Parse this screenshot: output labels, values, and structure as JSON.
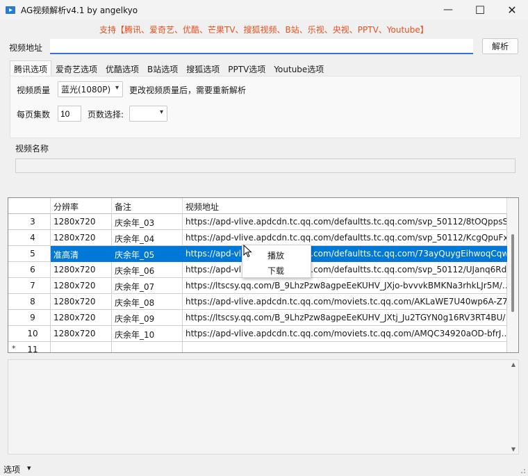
{
  "window": {
    "title": "AG视频解析v4.1 by angelkyo",
    "minimize_icon": "—",
    "maximize_icon": "☐",
    "close_icon": "✕"
  },
  "banner": "支持【腾讯、爱奇艺、优酷、芒果TV、搜狐视频、B站、乐视、央视、PPTV、Youtube】",
  "url_label": "视频地址",
  "url_value": "",
  "parse_button": "解析",
  "tabs": [
    "腾讯选项",
    "爱奇艺选项",
    "优酷选项",
    "B站选项",
    "搜狐选项",
    "PPTV选项",
    "Youtube选项"
  ],
  "quality": {
    "label": "视频质量",
    "value": "蓝光(1080P)",
    "note": "更改视频质量后，需要重新解析"
  },
  "paging": {
    "per_page_label": "每页集数",
    "per_page_value": "10",
    "page_select_label": "页数选择:",
    "page_select_value": ""
  },
  "video_name_label": "视频名称",
  "video_name_value": "",
  "table": {
    "columns": [
      "分辨率",
      "备注",
      "视频地址"
    ],
    "rows": [
      {
        "num": "3",
        "res": "1280x720",
        "note": "庆余年_03",
        "url": "https://apd-vlive.apdcdn.tc.qq.com/defaultts.tc.qq.com/svp_50112/8tOQppsS…"
      },
      {
        "num": "4",
        "res": "1280x720",
        "note": "庆余年_04",
        "url": "https://apd-vlive.apdcdn.tc.qq.com/defaultts.tc.qq.com/svp_50112/KcgQpuFx…"
      },
      {
        "num": "5",
        "res": "准高清",
        "note": "庆余年_05",
        "url": "https://apd-vlive.apdcdn.tc.qq.com/defaultts.tc.qq.com/73ayQuygEihwoqCqw…"
      },
      {
        "num": "6",
        "res": "1280x720",
        "note": "庆余年_06",
        "url": "https://apd-vlive.apdcdn.tc.qq.com/defaultts.tc.qq.com/svp_50112/UJanq6Rd…"
      },
      {
        "num": "7",
        "res": "1280x720",
        "note": "庆余年_07",
        "url": "https://ltscsy.qq.com/B_9LhzPzw8agpeEeKUHV_JXjo-bvvvkBMKNa3rhkLJr5M/…"
      },
      {
        "num": "8",
        "res": "1280x720",
        "note": "庆余年_08",
        "url": "https://apd-vlive.apdcdn.tc.qq.com/moviets.tc.qq.com/AKLaWE7U40wp6A-Z7…"
      },
      {
        "num": "9",
        "res": "1280x720",
        "note": "庆余年_09",
        "url": "https://ltscsy.qq.com/B_9LhzPzw8agpeEeKUHV_JXtj_Ju2TGYN0g16RV3RT4BU/…"
      },
      {
        "num": "10",
        "res": "1280x720",
        "note": "庆余年_10",
        "url": "https://apd-vlive.apdcdn.tc.qq.com/moviets.tc.qq.com/AMQC34920aOD-bfrJ…"
      },
      {
        "num": "11",
        "res": "",
        "note": "",
        "url": ""
      }
    ],
    "selected_row": "5",
    "current_row_marker": "▸",
    "new_row_marker": "*"
  },
  "context_menu": [
    "播放",
    "下载"
  ],
  "status": {
    "options_label": "选项",
    "dropdown_icon": "▾"
  }
}
